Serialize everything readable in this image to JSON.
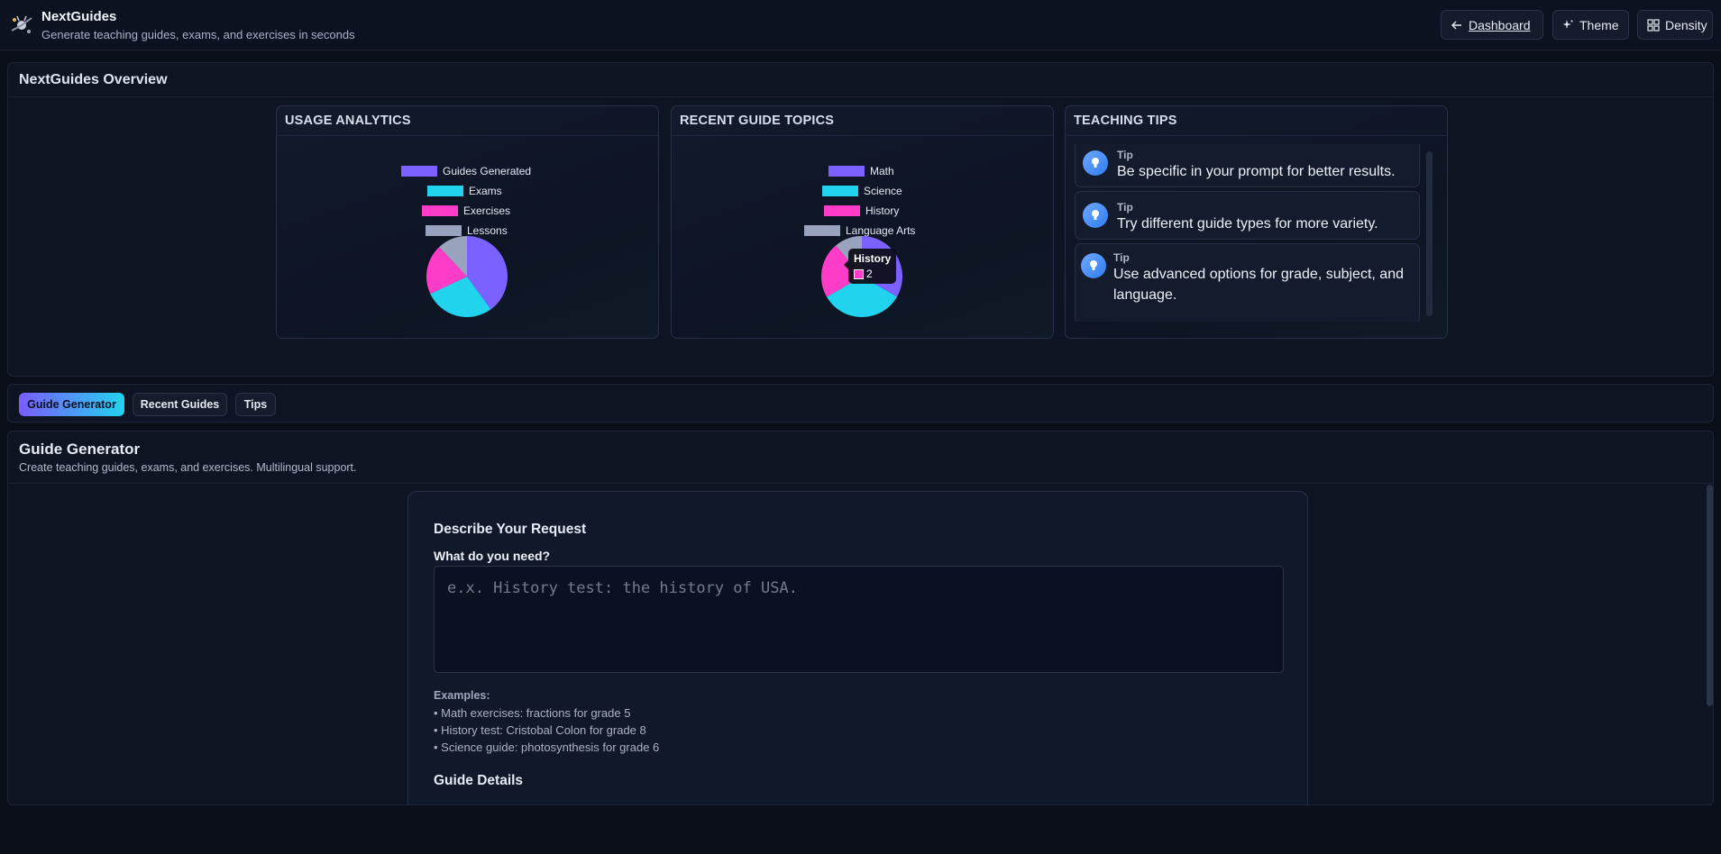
{
  "header": {
    "app_title": "NextGuides",
    "app_subtitle": "Generate teaching guides, exams, and exercises in seconds",
    "dashboard_label": "Dashboard",
    "theme_label": "Theme",
    "density_label": "Density"
  },
  "overview": {
    "title": "NextGuides Overview",
    "usage_card": {
      "title": "USAGE ANALYTICS",
      "legend": [
        "Guides Generated",
        "Exams",
        "Exercises",
        "Lessons"
      ]
    },
    "topics_card": {
      "title": "RECENT GUIDE TOPICS",
      "legend": [
        "Math",
        "Science",
        "History",
        "Language Arts"
      ],
      "tooltip": {
        "title": "History",
        "value": "2"
      }
    },
    "tips_card": {
      "title": "TEACHING TIPS",
      "tips": [
        {
          "label": "Tip",
          "text": "Be specific in your prompt for better results."
        },
        {
          "label": "Tip",
          "text": "Try different guide types for more variety."
        },
        {
          "label": "Tip",
          "text": "Use advanced options for grade, subject, and language."
        }
      ]
    }
  },
  "tabs": [
    "Guide Generator",
    "Recent Guides",
    "Tips"
  ],
  "generator": {
    "title": "Guide Generator",
    "subtitle": "Create teaching guides, exams, and exercises. Multilingual support.",
    "section_request": "Describe Your Request",
    "field_label": "What do you need?",
    "field_placeholder": "e.x. History test: the history of USA.",
    "field_value": "",
    "examples_heading": "Examples:",
    "examples": [
      "• Math exercises: fractions for grade 5",
      "• History test: Cristobal Colon for grade 8",
      "• Science guide: photosynthesis for grade 6"
    ],
    "section_details": "Guide Details"
  },
  "chart_data": [
    {
      "type": "pie",
      "title": "USAGE ANALYTICS",
      "categories": [
        "Guides Generated",
        "Exams",
        "Exercises",
        "Lessons"
      ],
      "values": [
        40,
        28,
        20,
        12
      ],
      "colors": [
        "#7b61ff",
        "#22d3ee",
        "#ff3cc7",
        "#9aa3bd"
      ],
      "legend": "top"
    },
    {
      "type": "pie",
      "title": "RECENT GUIDE TOPICS",
      "categories": [
        "Math",
        "Science",
        "History",
        "Language Arts"
      ],
      "values": [
        3,
        3,
        2,
        1
      ],
      "colors": [
        "#7b61ff",
        "#22d3ee",
        "#ff3cc7",
        "#9aa3bd"
      ],
      "legend": "top"
    }
  ],
  "colors": {
    "accent_purple": "#7b61ff",
    "accent_cyan": "#22d3ee",
    "accent_pink": "#ff3cc7",
    "accent_gray": "#9aa3bd"
  }
}
